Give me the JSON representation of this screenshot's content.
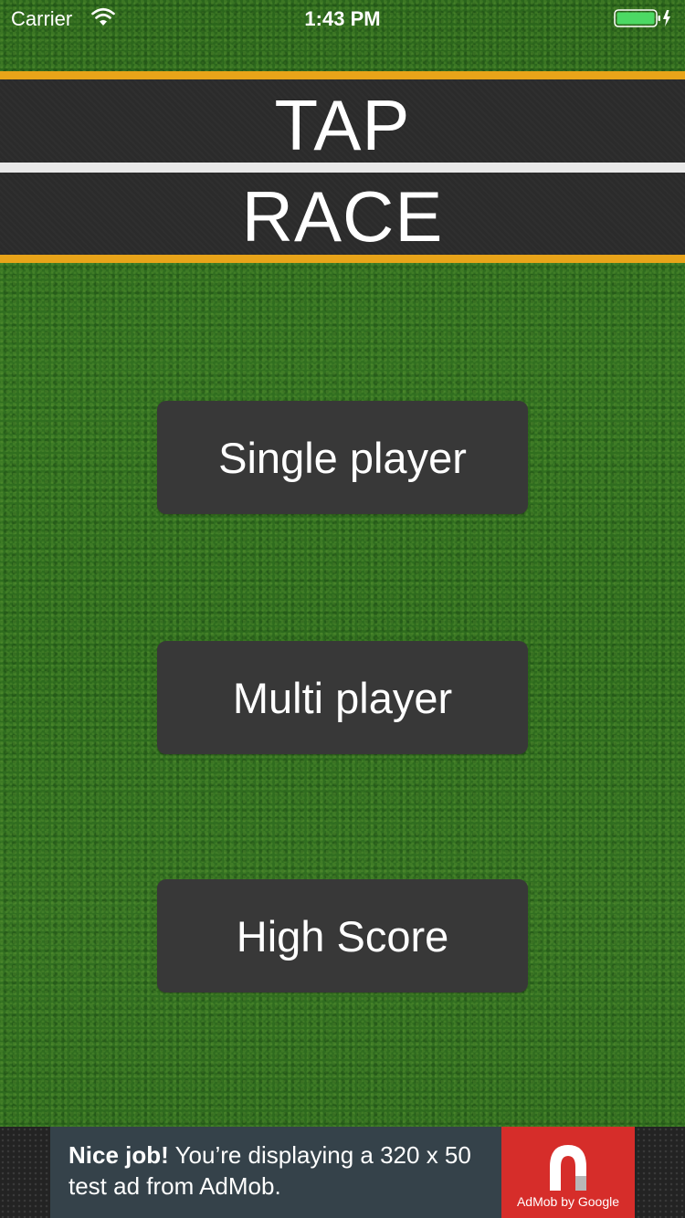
{
  "status_bar": {
    "carrier": "Carrier",
    "time": "1:43 PM",
    "wifi_icon": "wifi-icon",
    "battery_icon": "battery-charging-icon",
    "battery_color": "#4cd964"
  },
  "title": {
    "line1": "TAP",
    "line2": "RACE"
  },
  "menu": {
    "single_player": "Single player",
    "multi_player": "Multi player",
    "high_score": "High Score"
  },
  "ad": {
    "headline": "Nice job!",
    "body": "You’re displaying a 320 x 50 test ad from AdMob.",
    "logo_icon": "admob-icon",
    "brand": "AdMob by Google",
    "brand_color": "#d62d2a"
  },
  "colors": {
    "grass": "#2f6a1d",
    "road": "#2b2b2b",
    "road_edge": "#e8a419",
    "road_center": "#e9e9e9",
    "button": "#383838"
  }
}
